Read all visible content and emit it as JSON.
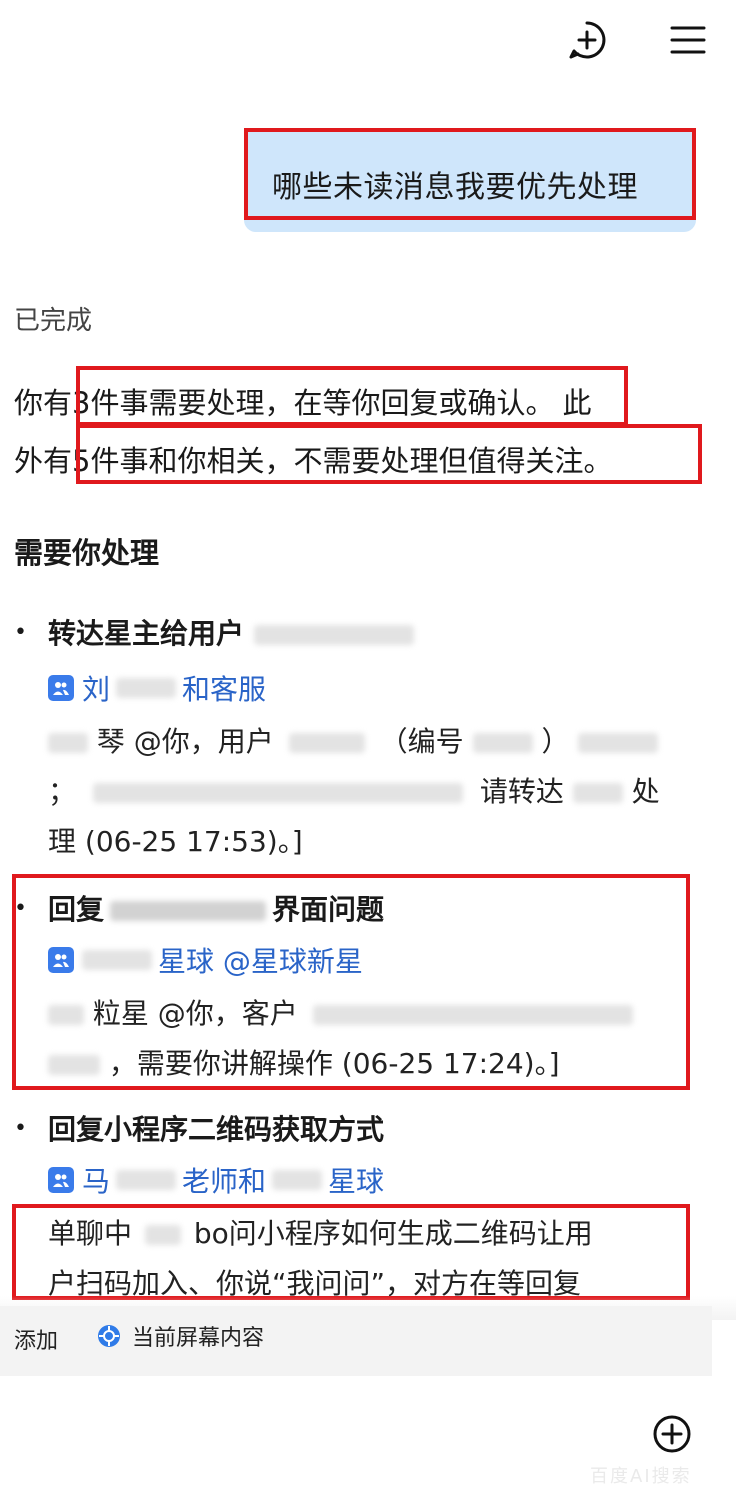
{
  "header": {
    "new_chat_icon": "plus-circle-icon",
    "menu_icon": "hamburger-menu-icon"
  },
  "conversation": {
    "user_message": "哪些未读消息我要优先处理",
    "status": "已完成",
    "summary": {
      "line1_prefix": "你有",
      "line1_highlight": "3件事需要处理，在等你回复或确认。",
      "line1_suffix": "此",
      "line2_prefix": "外有",
      "line2_highlight": "5件事和你相关，不需要处理但值得关注。"
    },
    "section_title": "需要你处理",
    "items": [
      {
        "bullet": "•",
        "title": "转达星主给用户",
        "group": {
          "pre": "刘",
          "post": "和客服"
        },
        "body_lines": [
          {
            "a": "琴 @你，用户",
            "b": "（编号",
            "c": "）"
          },
          {
            "a": "；",
            "b": "请转达",
            "c": "处"
          },
          {
            "a": "理 (06-25 17:53)。]"
          }
        ]
      },
      {
        "bullet": "•",
        "title_prefix": "回复",
        "title_suffix": "界面问题",
        "group": {
          "post": "星球 @星球新星"
        },
        "body_lines": [
          {
            "a": "粒星 @你，客户"
          },
          {
            "a": "，需要你讲解操作 (06-25 17:24)。]"
          }
        ]
      },
      {
        "bullet": "•",
        "title": "回复小程序二维码获取方式",
        "group": {
          "pre": "马",
          "mid": "老师和",
          "post": "星球"
        },
        "body_lines": [
          {
            "a": "单聊中",
            "b": "bo问小程序如何生成二维码让用"
          },
          {
            "a": "户扫码加入、你说“我问问”，对方在等回复"
          }
        ]
      }
    ]
  },
  "composer": {
    "add_label": "添加",
    "screen_chip_label": "当前屏幕内容",
    "screen_chip_icon": "crosshair-target-icon",
    "send_icon": "plus-circle-icon"
  },
  "watermark": "百度AI搜索",
  "colors": {
    "highlight": "#e0191d",
    "user_bubble": "#cfe6fb",
    "link": "#2a64c8",
    "group_icon": "#3a7bea"
  }
}
